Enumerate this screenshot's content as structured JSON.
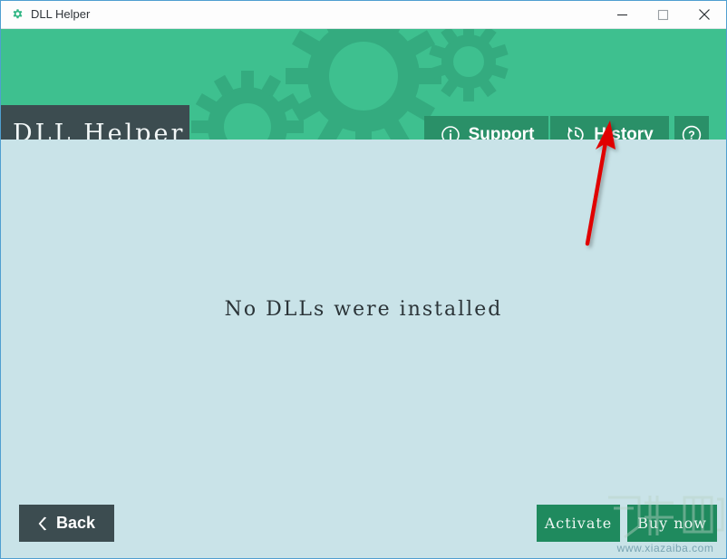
{
  "window": {
    "title": "DLL Helper",
    "icon": "gear-icon",
    "controls": {
      "minimize": "─",
      "maximize": "□",
      "close": "✕"
    },
    "colors": {
      "titlebar_bg": "#fdfdfd",
      "header_green": "#3ec08f",
      "button_green": "#2a9068",
      "dark_slate": "#3c4c50",
      "body_bg": "#c9e3e8",
      "footer_button_green": "#1f8a5e",
      "annotation_red": "#e00000",
      "window_border": "#4f9fd0"
    }
  },
  "header": {
    "logo_text": "DLL Helper",
    "buttons": [
      {
        "id": "support",
        "label": "Support",
        "icon": "info-circle-icon"
      },
      {
        "id": "history",
        "label": "History",
        "icon": "history-clock-icon"
      },
      {
        "id": "help",
        "label": "?",
        "icon": "question-circle-icon"
      }
    ]
  },
  "main": {
    "empty_message": "No DLLs were installed"
  },
  "footer": {
    "back_label": "Back",
    "back_icon": "chevron-left-icon",
    "activate_label": "Activate",
    "buy_now_label": "Buy now"
  },
  "annotation": {
    "type": "red-arrow",
    "points_to": "history-button"
  },
  "watermark": {
    "url": "www.xiazaiba.com"
  }
}
